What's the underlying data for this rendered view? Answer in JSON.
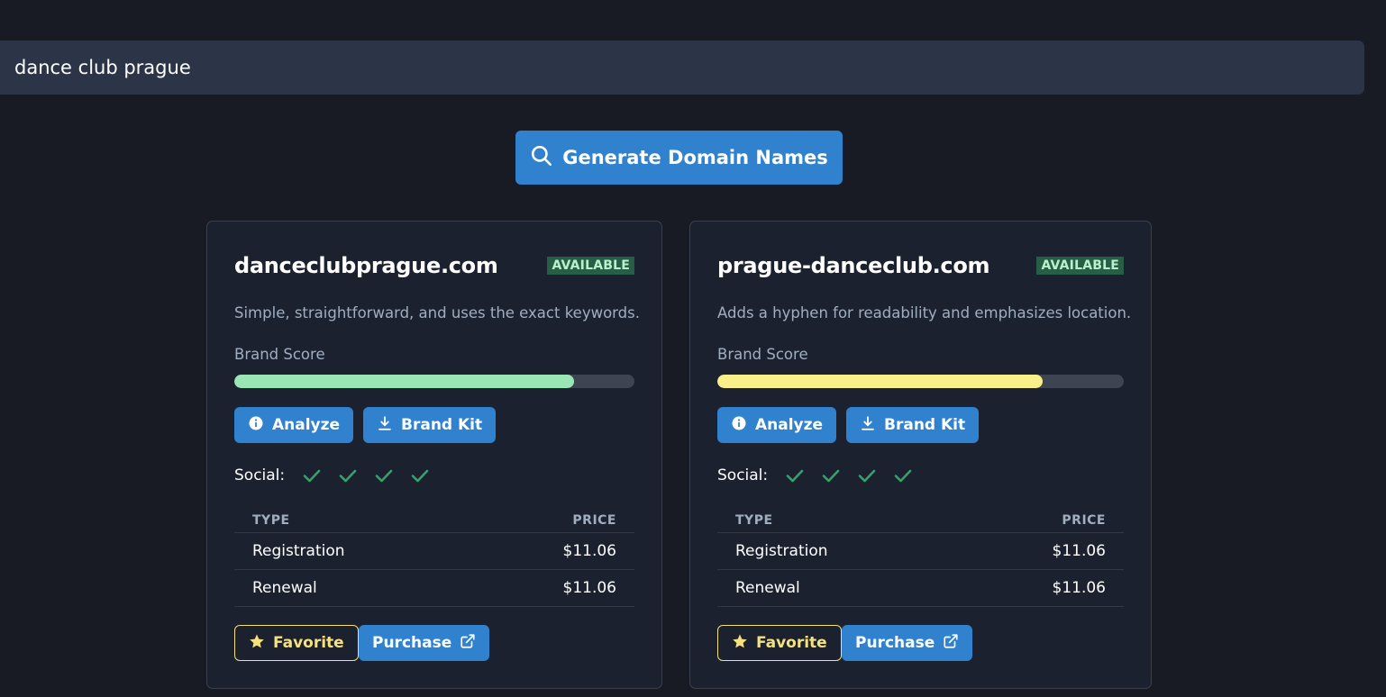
{
  "search": {
    "value": "dance club prague"
  },
  "generate_button": {
    "label": "Generate Domain Names",
    "icon": "search-icon"
  },
  "colors": {
    "accent": "#3182ce",
    "badge_bg": "#285e45",
    "badge_text": "#b9f0cd",
    "favorite": "#f6e27a",
    "check": "#38a169"
  },
  "cards": [
    {
      "domain": "danceclubprague.com",
      "status": "AVAILABLE",
      "description": "Simple, straightforward, and uses the exact keywords.",
      "brand_score_label": "Brand Score",
      "brand_score": 0.85,
      "bar_color": "#9ae6b4",
      "analyze_label": "Analyze",
      "brandkit_label": "Brand Kit",
      "social_label": "Social:",
      "social_checks": [
        "check-icon",
        "check-icon",
        "check-icon",
        "check-icon"
      ],
      "table": {
        "headers": [
          "TYPE",
          "PRICE"
        ],
        "rows": [
          {
            "type": "Registration",
            "price": "$11.06"
          },
          {
            "type": "Renewal",
            "price": "$11.06"
          }
        ]
      },
      "favorite_label": "Favorite",
      "purchase_label": "Purchase"
    },
    {
      "domain": "prague-danceclub.com",
      "status": "AVAILABLE",
      "description": "Adds a hyphen for readability and emphasizes location.",
      "brand_score_label": "Brand Score",
      "brand_score": 0.8,
      "bar_color": "#faf089",
      "analyze_label": "Analyze",
      "brandkit_label": "Brand Kit",
      "social_label": "Social:",
      "social_checks": [
        "check-icon",
        "check-icon",
        "check-icon",
        "check-icon"
      ],
      "table": {
        "headers": [
          "TYPE",
          "PRICE"
        ],
        "rows": [
          {
            "type": "Registration",
            "price": "$11.06"
          },
          {
            "type": "Renewal",
            "price": "$11.06"
          }
        ]
      },
      "favorite_label": "Favorite",
      "purchase_label": "Purchase"
    }
  ]
}
